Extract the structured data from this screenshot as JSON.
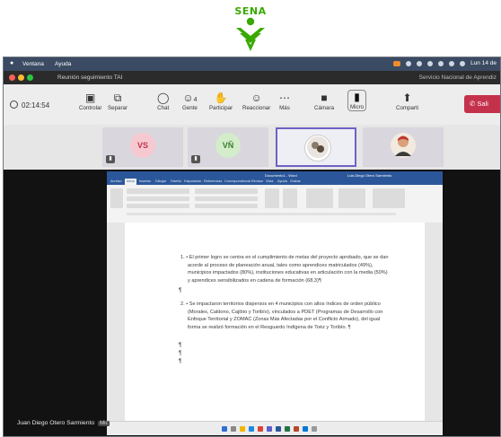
{
  "logo": {
    "text": "SENA",
    "color": "#39a900"
  },
  "menubar": {
    "items": [
      "Ventana",
      "Ayuda"
    ],
    "clock": "Lun 14 de"
  },
  "window": {
    "title": "Reunión seguimiento TAI",
    "org": "Servicio Nacional de Aprendiz"
  },
  "toolbar": {
    "timer": "02:14:54",
    "buttons": [
      {
        "label": "Controlar",
        "icon": "screen-control-icon"
      },
      {
        "label": "Separar",
        "icon": "pop-out-icon"
      },
      {
        "label": "Chat",
        "icon": "chat-icon"
      },
      {
        "label": "Gente",
        "icon": "people-icon",
        "count": "4"
      },
      {
        "label": "Participar",
        "icon": "raise-hand-icon"
      },
      {
        "label": "Reaccionar",
        "icon": "react-icon"
      },
      {
        "label": "Más",
        "icon": "more-icon"
      },
      {
        "label": "Cámara",
        "icon": "camera-off-icon"
      },
      {
        "label": "Micro",
        "icon": "mic-icon"
      },
      {
        "label": "Comparti",
        "icon": "share-icon"
      }
    ],
    "leave_label": "Sali",
    "leave_color": "#c4314b"
  },
  "participants": [
    {
      "initials": "VS",
      "color": "#c0344c",
      "bg": "#f6c9d1"
    },
    {
      "initials": "VŇ",
      "color": "#3a7d33",
      "bg": "#d3ecc9"
    },
    {
      "initials": "",
      "type": "photo"
    },
    {
      "initials": "",
      "type": "photo-person"
    }
  ],
  "word": {
    "title": "Documento1 - Word",
    "user": "Luis Diego Otero Sarmiento",
    "tabs": [
      "Archivo",
      "Inicio",
      "Insertar",
      "Dibujar",
      "Diseño",
      "Disposición",
      "Referencias",
      "Correspondencia",
      "Revisar",
      "Vista",
      "Ayuda",
      "Grabar"
    ],
    "paragraphs": [
      {
        "lines": [
          "1. • El primer logro se centra en el cumplimiento de metas del proyecto aprobado, que se dan",
          "acorde al proceso de planeación anual, tales como aprendices matriculados (49%),",
          "municipios impactados (80%), instituciones educativas en articulación con la media (50%)",
          "y aprendices sensibilizados en cadena de formación (68,3)¶"
        ]
      },
      {
        "lines": [
          "2. • Se impactaron territorios dispersos en 4 municipios con altos índices de orden público",
          "(Morales, Caldono, Cajibío y Toribío), vinculados a PDET (Programas de Desarrollo con",
          "Enfoque Territorial y ZOMAC (Zonas Más Afectadas por el Conflicto Armado), del igual",
          "forma se realizó formación en el Resguardo Indígena de Toéz y Toribío. ¶"
        ]
      }
    ],
    "pilcrow": "¶"
  },
  "presenter": {
    "name": "Juan Diego Otero Sarmiento",
    "badge": "Mic"
  }
}
